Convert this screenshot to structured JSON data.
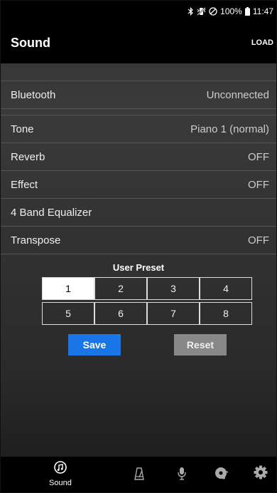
{
  "status": {
    "battery": "100%",
    "time": "11:47"
  },
  "appbar": {
    "title": "Sound",
    "load_label": "LOAD"
  },
  "rows": {
    "bluetooth": {
      "label": "Bluetooth",
      "value": "Unconnected"
    },
    "tone": {
      "label": "Tone",
      "value": "Piano 1 (normal)"
    },
    "reverb": {
      "label": "Reverb",
      "value": "OFF"
    },
    "effect": {
      "label": "Effect",
      "value": "OFF"
    },
    "equalizer": {
      "label": "4 Band Equalizer"
    },
    "transpose": {
      "label": "Transpose",
      "value": "OFF"
    }
  },
  "user_preset": {
    "title": "User Preset",
    "cells": [
      "1",
      "2",
      "3",
      "4",
      "5",
      "6",
      "7",
      "8"
    ],
    "selected": "1",
    "save_label": "Save",
    "reset_label": "Reset"
  },
  "tabbar": {
    "tabs": [
      {
        "icon": "sound-icon",
        "label": "Sound",
        "active": true
      },
      {
        "icon": "metronome-icon"
      },
      {
        "icon": "microphone-icon"
      },
      {
        "icon": "record-disc-icon"
      },
      {
        "icon": "gear-icon"
      }
    ]
  },
  "colors": {
    "accent": "#1976e6",
    "reset": "#888888"
  }
}
